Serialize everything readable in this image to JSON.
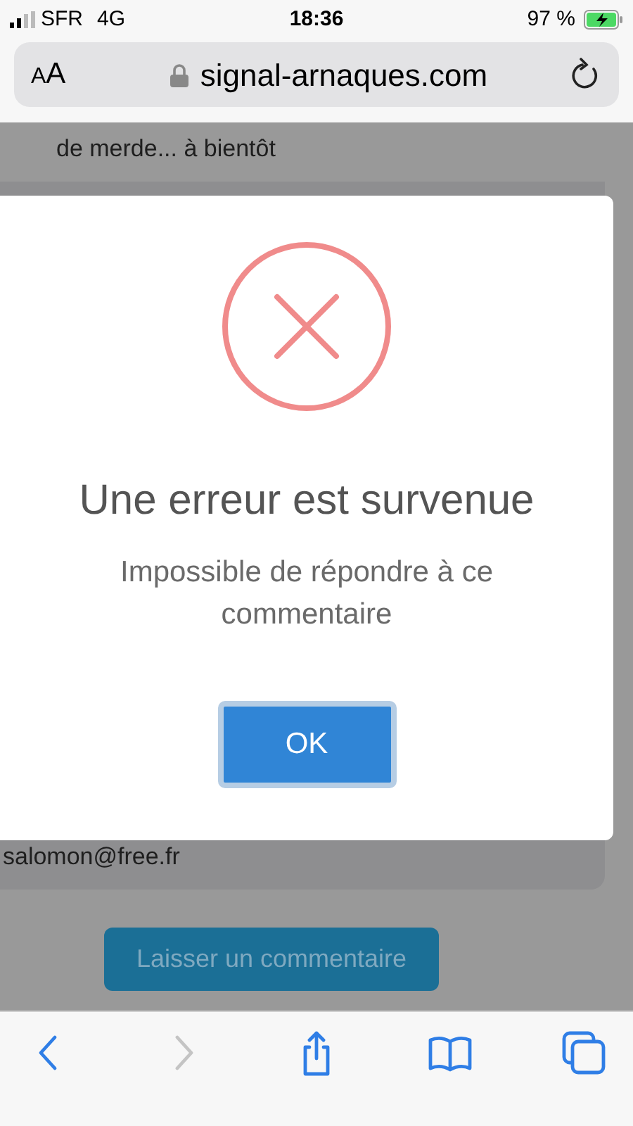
{
  "status_bar": {
    "carrier": "SFR",
    "network": "4G",
    "time": "18:36",
    "battery": "97 %",
    "charging": true
  },
  "address_bar": {
    "text_size": "AA",
    "url": "signal-arnaques.com"
  },
  "page": {
    "comment_end": "de merde... à bientôt",
    "email": "salomon@free.fr",
    "leave_comment_button": "Laisser un commentaire"
  },
  "dialog": {
    "title": "Une erreur est survenue",
    "message": "Impossible de répondre à ce commentaire",
    "ok_button": "OK"
  },
  "toolbar": [
    {
      "kind": "back",
      "disabled": false
    },
    {
      "kind": "forward",
      "disabled": true
    },
    {
      "kind": "share",
      "disabled": false
    },
    {
      "kind": "bookmarks",
      "disabled": false
    },
    {
      "kind": "tabs",
      "disabled": false
    }
  ]
}
